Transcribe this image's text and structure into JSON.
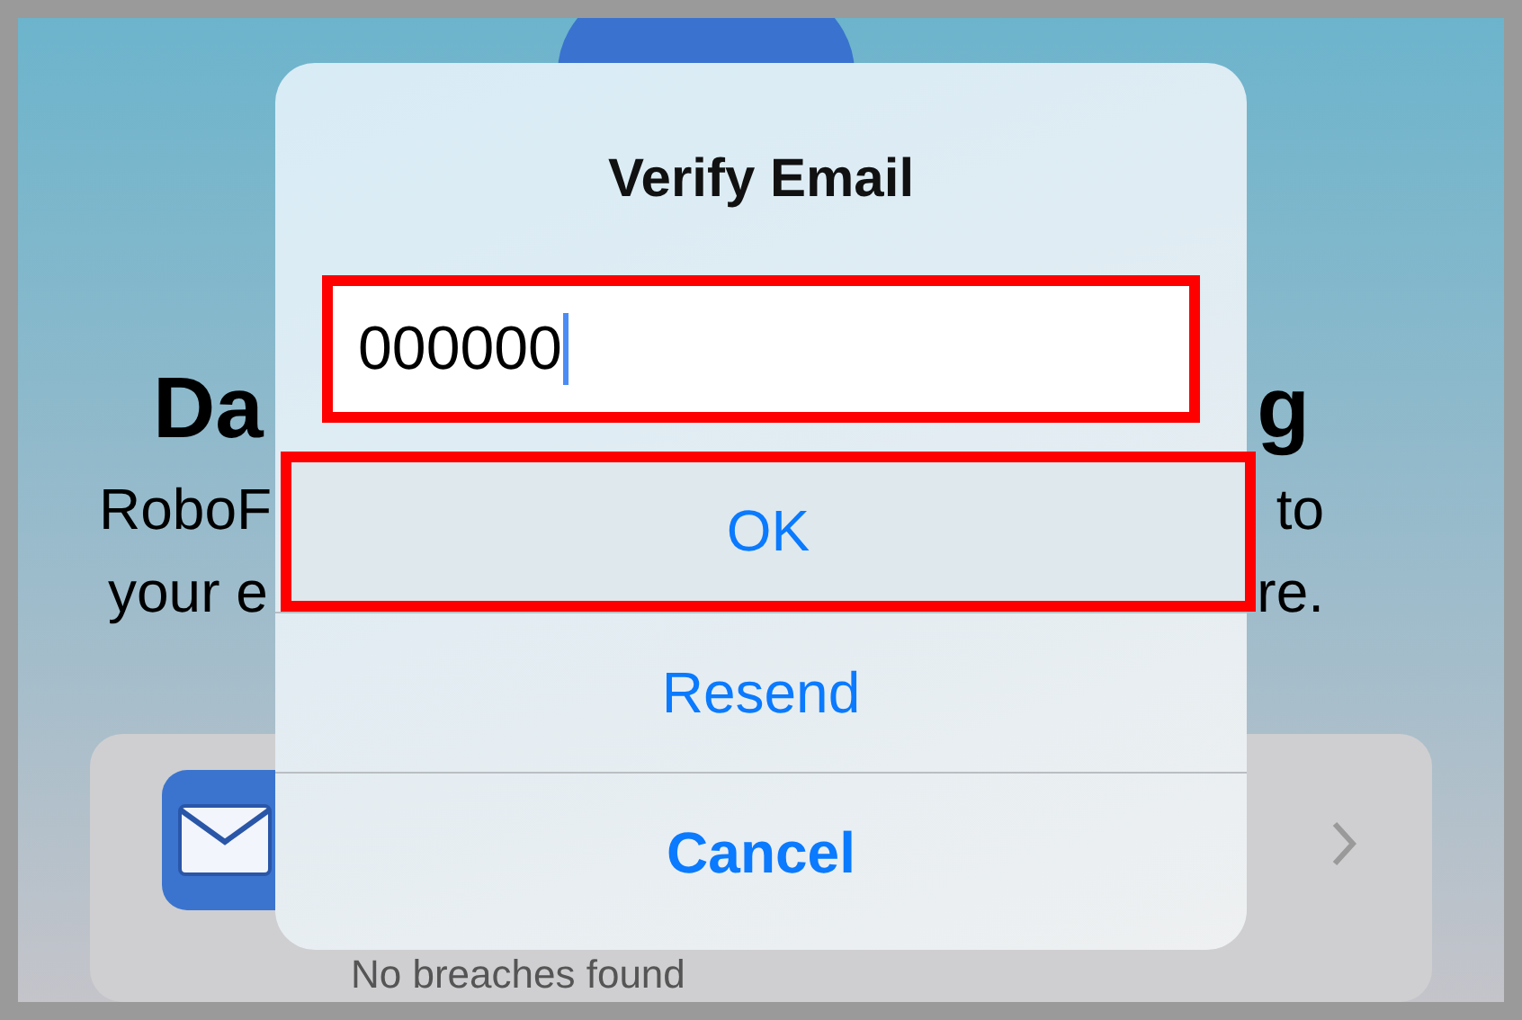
{
  "background": {
    "heading": {
      "left": "Da",
      "right": "g"
    },
    "description": [
      {
        "left": "RoboF",
        "right": "to"
      },
      {
        "left": "your e",
        "right": "re."
      }
    ],
    "card": {
      "status": "No breaches found"
    }
  },
  "dialog": {
    "title": "Verify Email",
    "field": {
      "value": "000000",
      "focused": true,
      "highlighted": true
    },
    "buttons": [
      {
        "label": "OK",
        "kind": "default",
        "highlighted": true
      },
      {
        "label": "Resend",
        "kind": "default",
        "highlighted": false
      },
      {
        "label": "Cancel",
        "kind": "cancel",
        "highlighted": false
      }
    ]
  }
}
